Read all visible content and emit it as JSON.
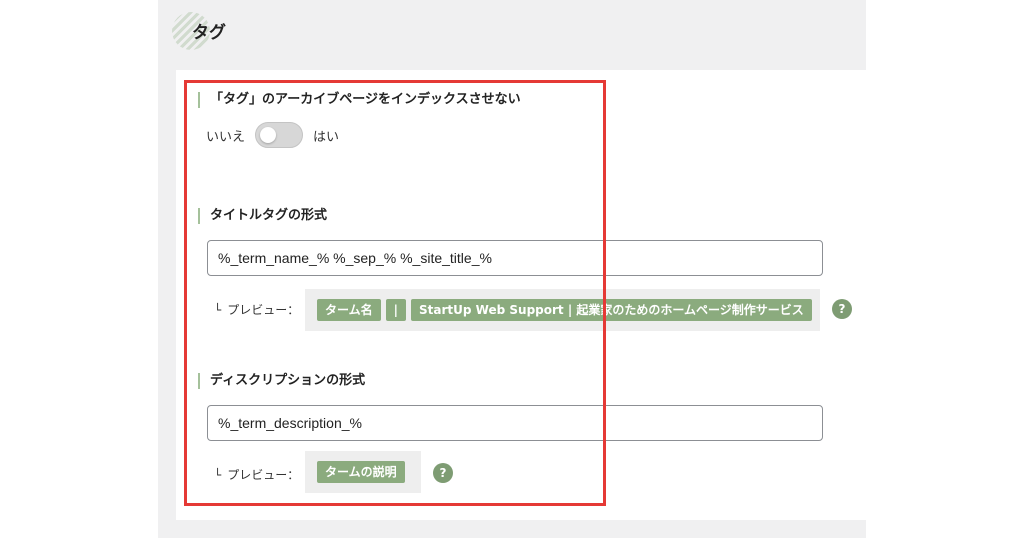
{
  "section": {
    "title": "タグ"
  },
  "noindex": {
    "label": "「タグ」のアーカイブページをインデックスさせない",
    "off_label": "いいえ",
    "on_label": "はい",
    "enabled": false
  },
  "title_format": {
    "label": "タイトルタグの形式",
    "value": "%_term_name_% %_sep_% %_site_title_%",
    "preview_label": "プレビュー：",
    "preview_chips": [
      "ターム名",
      "|",
      "StartUp Web Support | 起業家のためのホームページ制作サービス"
    ],
    "help": "?"
  },
  "description_format": {
    "label": "ディスクリプションの形式",
    "value": "%_term_description_%",
    "preview_label": "プレビュー：",
    "preview_chips": [
      "タームの説明"
    ],
    "help": "?"
  },
  "colors": {
    "chip": "#8bab7e",
    "help_icon": "#7e9c73",
    "highlight": "#e53935",
    "label_bar": "#a5c19b"
  }
}
